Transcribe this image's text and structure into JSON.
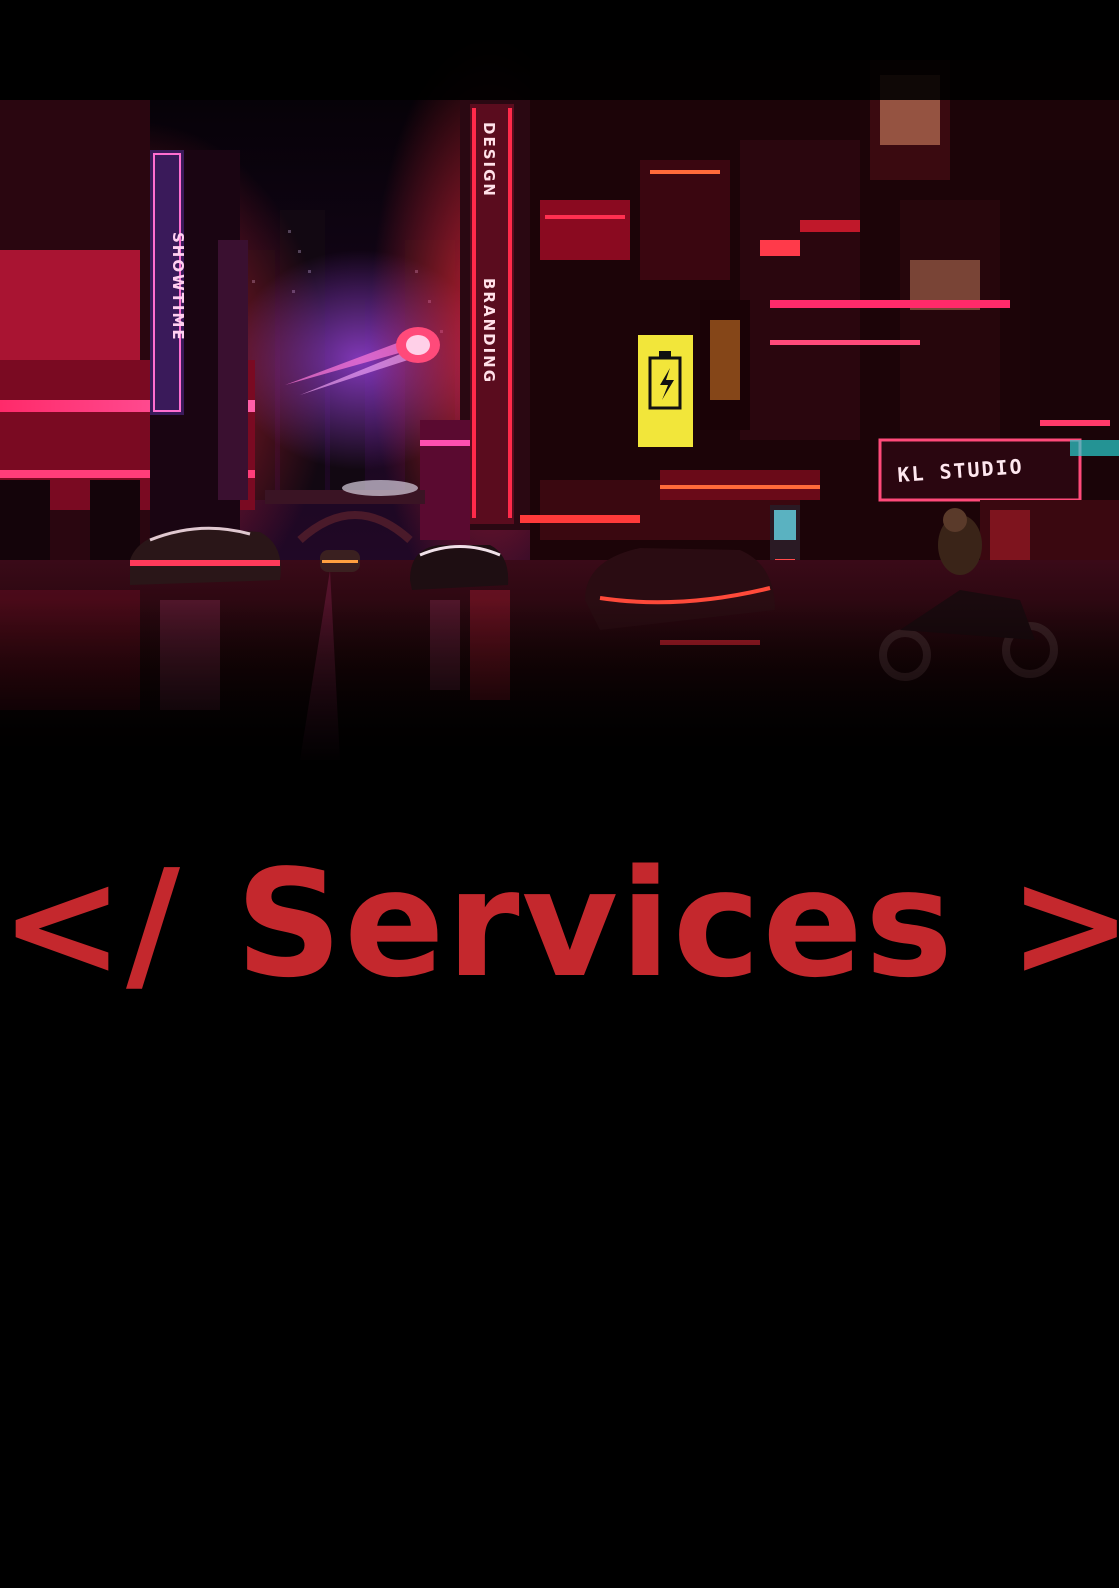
{
  "scene": {
    "signs": {
      "showtime": "SHOWTIME",
      "design": "DESIGN",
      "branding": "BRANDING",
      "studio": "KL STUDIO"
    }
  },
  "page": {
    "heading": "</ Services >",
    "heading_color": "#c4282d",
    "background": "#000000"
  }
}
